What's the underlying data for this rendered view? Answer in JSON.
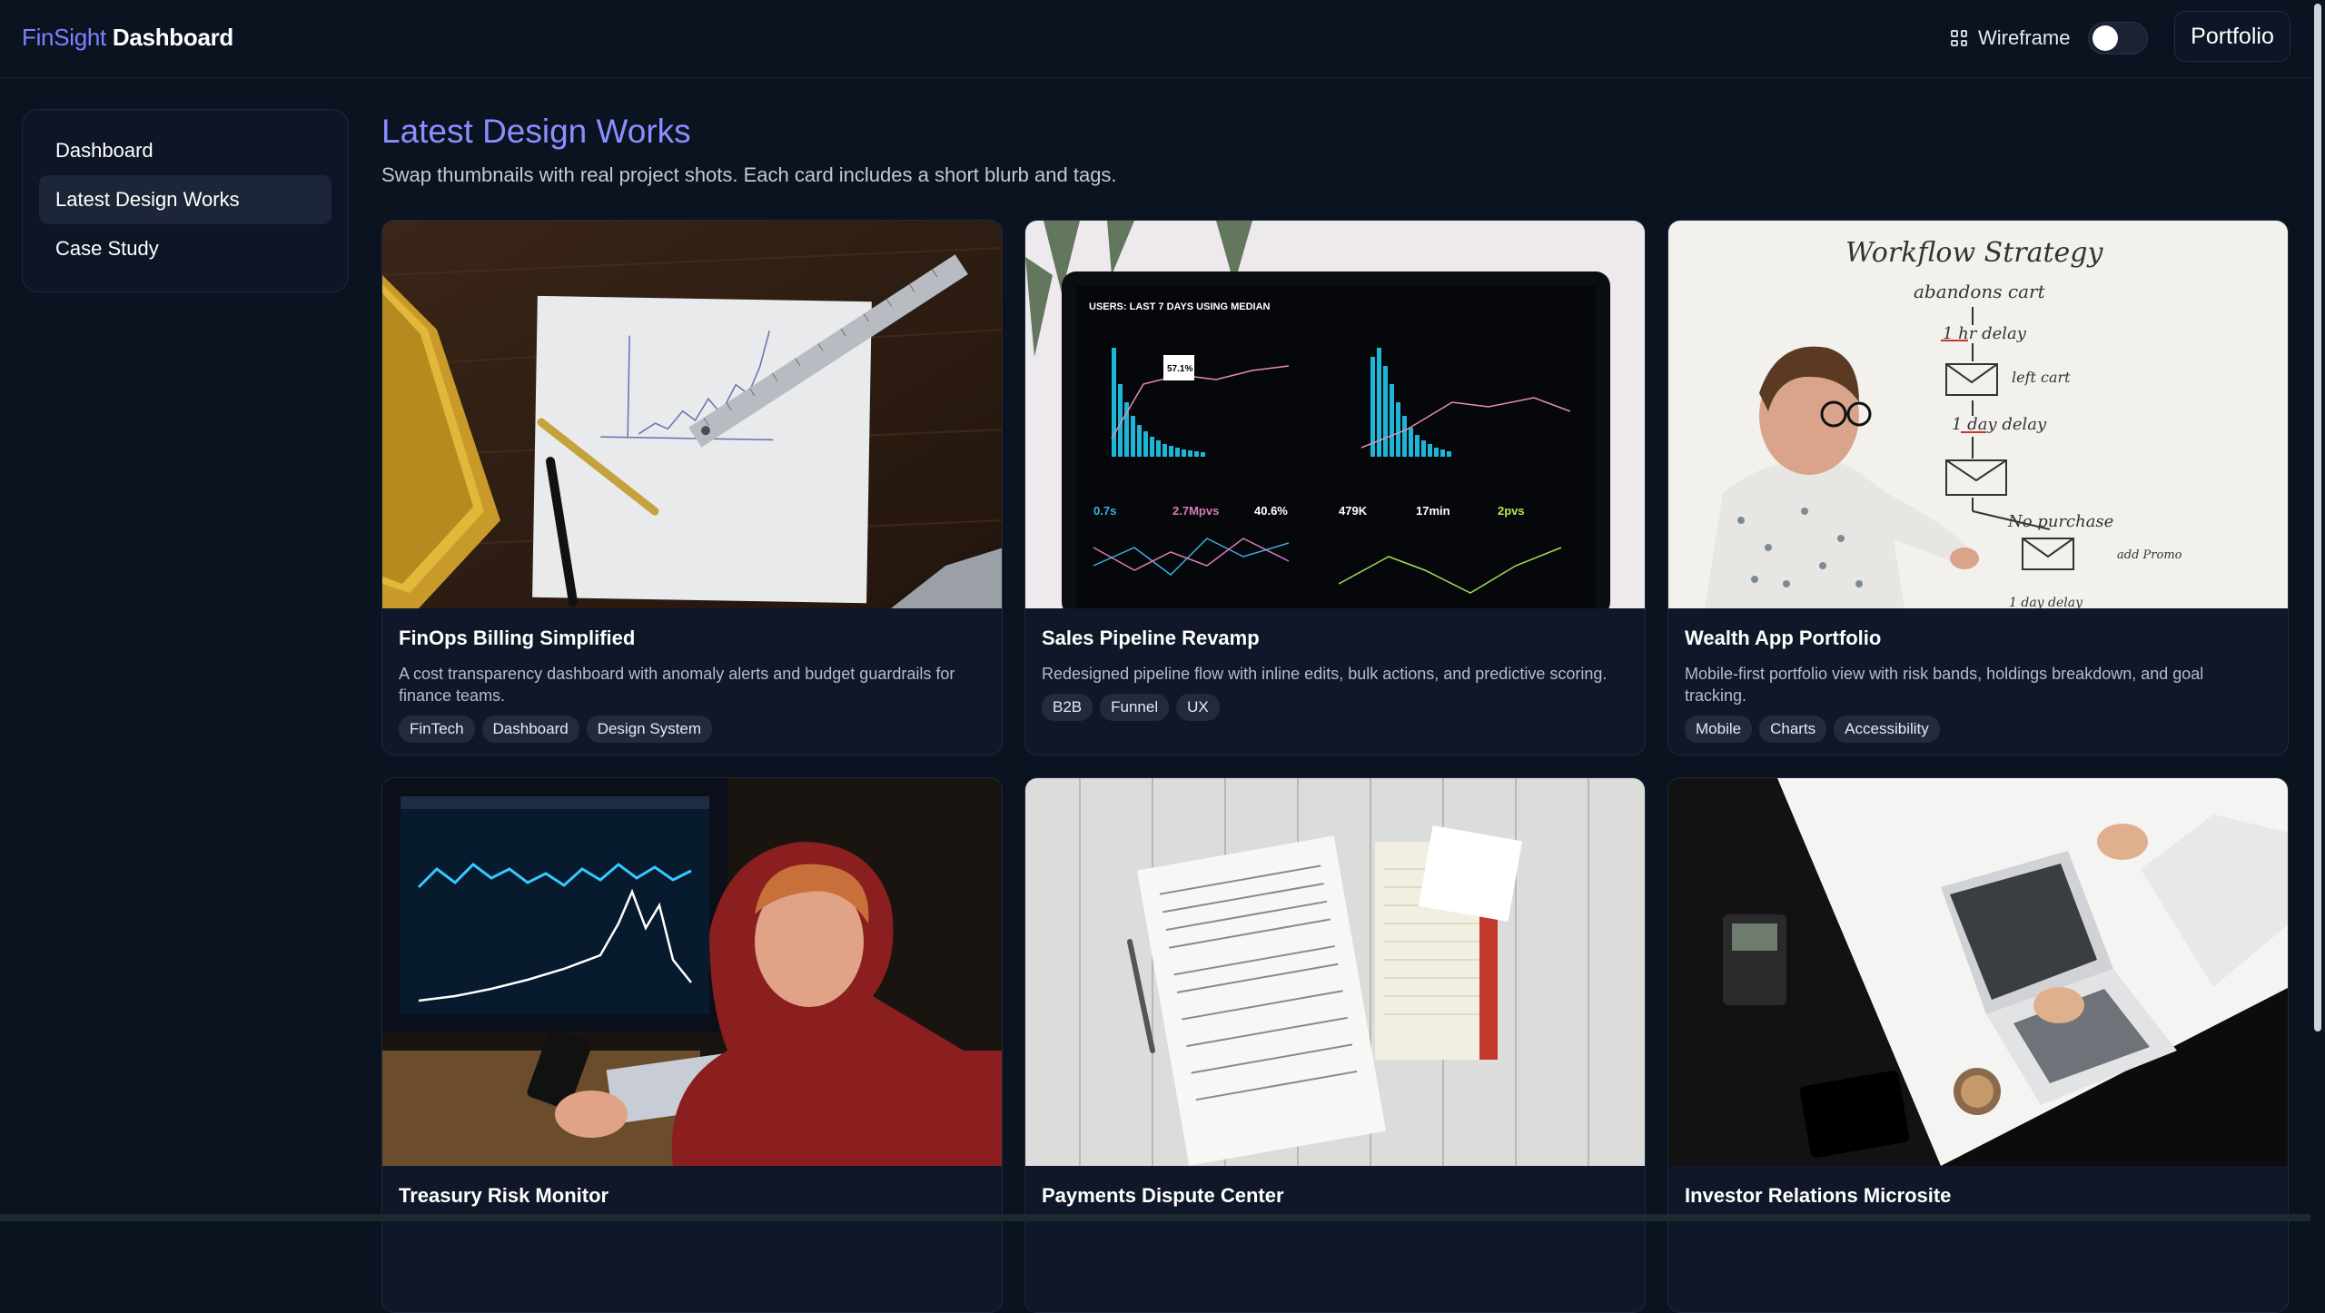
{
  "brand": {
    "accent": "FinSight",
    "rest": " Dashboard"
  },
  "header": {
    "wireframe_label": "Wireframe",
    "wireframe_on": false,
    "portfolio_label": "Portfolio"
  },
  "sidebar": {
    "items": [
      {
        "label": "Dashboard",
        "active": false
      },
      {
        "label": "Latest Design Works",
        "active": true
      },
      {
        "label": "Case Study",
        "active": false
      }
    ]
  },
  "main": {
    "title": "Latest Design Works",
    "subtitle": "Swap thumbnails with real project shots. Each card includes a short blurb and tags."
  },
  "cards": [
    {
      "title": "FinOps Billing Simplified",
      "desc": "A cost transparency dashboard with anomaly alerts and budget guardrails for finance teams.",
      "tags": [
        "FinTech",
        "Dashboard",
        "Design System"
      ],
      "thumb": "desk-chart-photo"
    },
    {
      "title": "Sales Pipeline Revamp",
      "desc": "Redesigned pipeline flow with inline edits, bulk actions, and predictive scoring.",
      "tags": [
        "B2B",
        "Funnel",
        "UX"
      ],
      "thumb": "analytics-monitor-photo"
    },
    {
      "title": "Wealth App Portfolio",
      "desc": "Mobile-first portfolio view with risk bands, holdings breakdown, and goal tracking.",
      "tags": [
        "Mobile",
        "Charts",
        "Accessibility"
      ],
      "thumb": "whiteboard-workflow-photo"
    },
    {
      "title": "Treasury Risk Monitor",
      "desc": "",
      "tags": [],
      "thumb": "trader-monitor-photo"
    },
    {
      "title": "Payments Dispute Center",
      "desc": "",
      "tags": [],
      "thumb": "paperwork-photo"
    },
    {
      "title": "Investor Relations Microsite",
      "desc": "",
      "tags": [],
      "thumb": "laptop-desk-photo"
    }
  ],
  "thumb_text": {
    "sales_header": "USERS: LAST 7 DAYS USING MEDIAN",
    "sales_callout": "57.1%",
    "sales_metrics": [
      "0.7s",
      "2.7Mpvs",
      "40.6%",
      "479K",
      "17min",
      "2pvs"
    ],
    "whiteboard_lines": [
      "Workflow  Strategy",
      "abandons cart",
      "1 hr delay",
      "left cart",
      "1 day delay",
      "No purchase",
      "add Promo",
      "1 day delay"
    ]
  },
  "colors": {
    "accent": "#7c83ff",
    "bg": "#0b1220",
    "card": "#0f1728",
    "tag_bg": "#222b3b"
  }
}
